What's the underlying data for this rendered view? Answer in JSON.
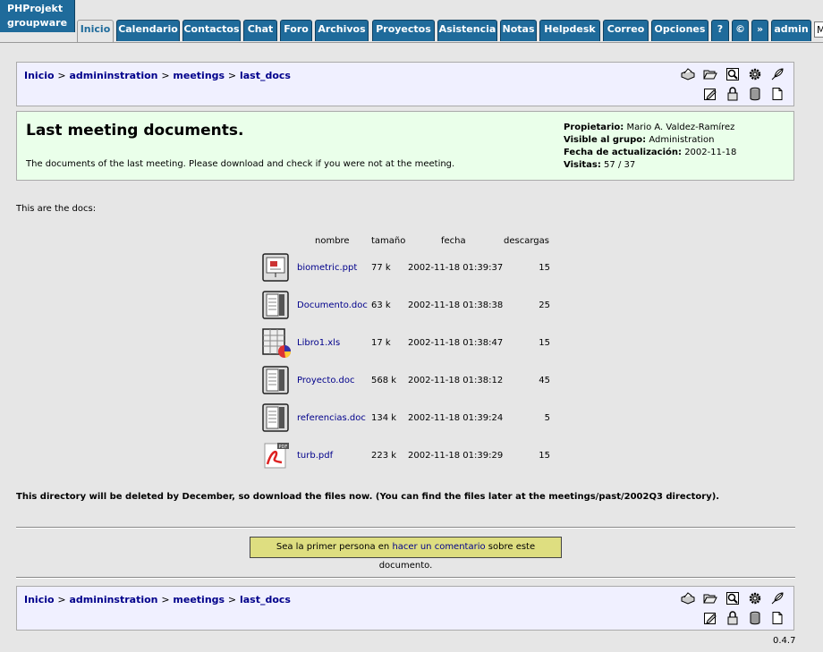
{
  "app": {
    "logo_line1": "PHProjekt",
    "logo_line2": "groupware"
  },
  "nav": {
    "tabs": [
      {
        "label": "Inicio",
        "active": true
      },
      {
        "label": "Calendario"
      },
      {
        "label": "Contactos"
      },
      {
        "label": "Chat"
      },
      {
        "label": "Foro"
      },
      {
        "label": "Archivos"
      },
      {
        "label": "Proyectos"
      },
      {
        "label": "Asistencia"
      },
      {
        "label": "Notas"
      },
      {
        "label": "Helpdesk"
      },
      {
        "label": "Correo"
      },
      {
        "label": "Opciones"
      },
      {
        "label": "?"
      },
      {
        "label": "©"
      },
      {
        "label": "»"
      },
      {
        "label": "admin"
      }
    ],
    "input_value": "M"
  },
  "breadcrumb": {
    "items": [
      "Inicio",
      "admininstration",
      "meetings",
      "last_docs"
    ],
    "separator": ">"
  },
  "toolbar_icons": [
    "print-icon",
    "folder-open-icon",
    "search-icon",
    "settings-icon",
    "feather-icon",
    "edit-icon",
    "lock-icon",
    "trash-icon",
    "new-document-icon"
  ],
  "document": {
    "title": "Last meeting documents.",
    "description": "The documents of the last meeting. Please download and check if you were not at the meeting.",
    "owner_label": "Propietario:",
    "owner": "Mario A. Valdez-Ramírez",
    "group_label": "Visible al grupo:",
    "group": "Administration",
    "updated_label": "Fecha de actualización:",
    "updated": "2002-11-18",
    "visits_label": "Visitas:",
    "visits": "57 / 37"
  },
  "intro": "This are the docs:",
  "table": {
    "headers": {
      "name": "nombre",
      "size": "tamaño",
      "date": "fecha",
      "downloads": "descargas"
    },
    "rows": [
      {
        "icon": "presentation-file-icon",
        "name": "biometric.ppt",
        "size": "77 k",
        "date": "2002-11-18 01:39:37",
        "downloads": "15"
      },
      {
        "icon": "word-document-icon",
        "name": "Documento.doc",
        "size": "63 k",
        "date": "2002-11-18 01:38:38",
        "downloads": "25"
      },
      {
        "icon": "spreadsheet-file-icon",
        "name": "Libro1.xls",
        "size": "17 k",
        "date": "2002-11-18 01:38:47",
        "downloads": "15"
      },
      {
        "icon": "word-document-icon",
        "name": "Proyecto.doc",
        "size": "568 k",
        "date": "2002-11-18 01:38:12",
        "downloads": "45"
      },
      {
        "icon": "word-document-icon",
        "name": "referencias.doc",
        "size": "134 k",
        "date": "2002-11-18 01:39:24",
        "downloads": "5"
      },
      {
        "icon": "pdf-file-icon",
        "name": "turb.pdf",
        "size": "223 k",
        "date": "2002-11-18 01:39:29",
        "downloads": "15"
      }
    ]
  },
  "notice": "This directory will be deleted by December, so download the files now. (You can find the files later at the meetings/past/2002Q3 directory).",
  "comment": {
    "prefix": "Sea la primer persona en",
    "link": "hacer un comentario",
    "suffix": "sobre este documento."
  },
  "footer": {
    "version": "0.4.7"
  }
}
